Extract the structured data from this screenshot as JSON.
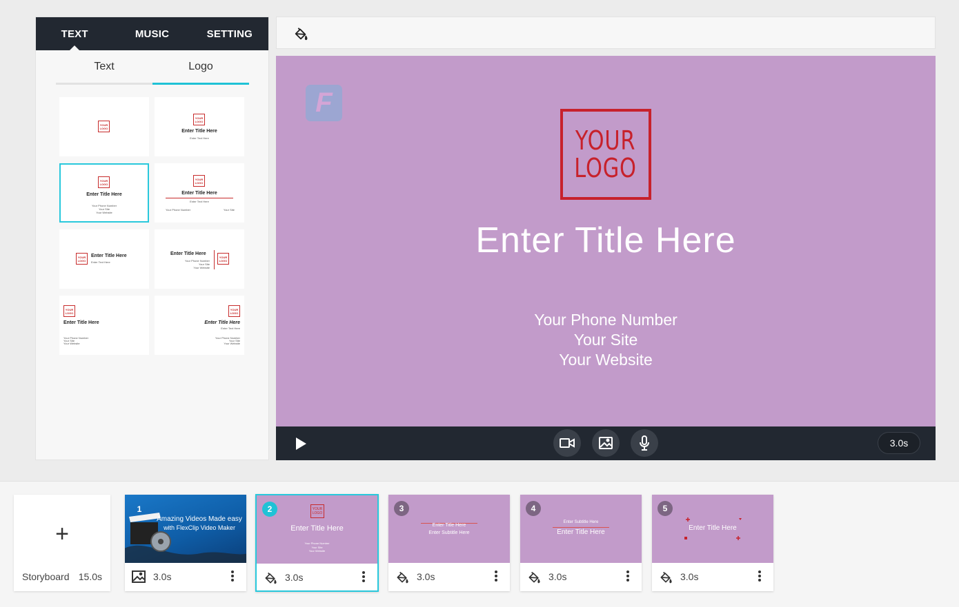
{
  "left_panel": {
    "tabs": [
      {
        "label": "TEXT",
        "active": true
      },
      {
        "label": "MUSIC",
        "active": false
      },
      {
        "label": "SETTING",
        "active": false
      }
    ],
    "sub_tabs": [
      {
        "label": "Text",
        "active": false
      },
      {
        "label": "Logo",
        "active": true
      }
    ],
    "templates": {
      "t1": {
        "logo": "YOUR LOGO"
      },
      "t2": {
        "logo": "YOUR LOGO",
        "title": "Enter Title Here",
        "subtitle": "Enter Text Here"
      },
      "t3": {
        "logo": "YOUR LOGO",
        "title": "Enter Title Here",
        "line1": "Your Phone Number",
        "line2": "Your Site",
        "line3": "Your Website"
      },
      "t4": {
        "logo": "YOUR LOGO",
        "title": "Enter Title Here",
        "subtitle": "Enter Text Here",
        "left": "Your Phone Number",
        "right": "Your Site"
      },
      "t5": {
        "logo": "YOUR LOGO",
        "title": "Enter Title Here",
        "subtitle": "Enter Text Here"
      },
      "t6": {
        "logo": "YOUR LOGO",
        "title": "Enter Title Here",
        "line1": "Your Phone Number",
        "line2": "Your Site",
        "line3": "Your Website"
      },
      "t7": {
        "logo": "YOUR LOGO",
        "title": "Enter Title Here",
        "line1": "Your Phone Number",
        "line2": "Your Site",
        "line3": "Your Website"
      },
      "t8": {
        "logo": "YOUR LOGO",
        "title": "Enter Title Here",
        "subtitle": "Enter Text Here",
        "line1": "Your Phone Number",
        "line2": "Your Site",
        "line3": "Your Website"
      }
    }
  },
  "toolbar": {
    "icon": "paint-bucket-icon"
  },
  "canvas": {
    "background": "#c29bca",
    "watermark": "F",
    "logo_line1": "YOUR",
    "logo_line2": "LOGO",
    "title": "Enter Title Here",
    "phone": "Your Phone Number",
    "site": "Your Site",
    "website": "Your Website"
  },
  "player": {
    "duration": "3.0s",
    "icons": [
      "play-icon",
      "video-camera-icon",
      "image-icon",
      "microphone-icon"
    ]
  },
  "storyboard": {
    "label": "Storyboard",
    "total": "15.0s",
    "clips": [
      {
        "number": "1",
        "duration": "3.0s",
        "line1": "Amazing Videos Made easy",
        "line2": "with FlexClip Video Maker"
      },
      {
        "number": "2",
        "duration": "3.0s",
        "logo": "YOUR LOGO",
        "title": "Enter Title Here",
        "line1": "Your Phone Number",
        "line2": "Your Site",
        "line3": "Your Website"
      },
      {
        "number": "3",
        "duration": "3.0s",
        "title": "Enter Title Here",
        "subtitle": "Enter Subtitle Here"
      },
      {
        "number": "4",
        "duration": "3.0s",
        "subtitle": "Enter Subtitle Here",
        "title": "Enter Title Here"
      },
      {
        "number": "5",
        "duration": "3.0s",
        "title": "Enter Title Here"
      }
    ]
  }
}
